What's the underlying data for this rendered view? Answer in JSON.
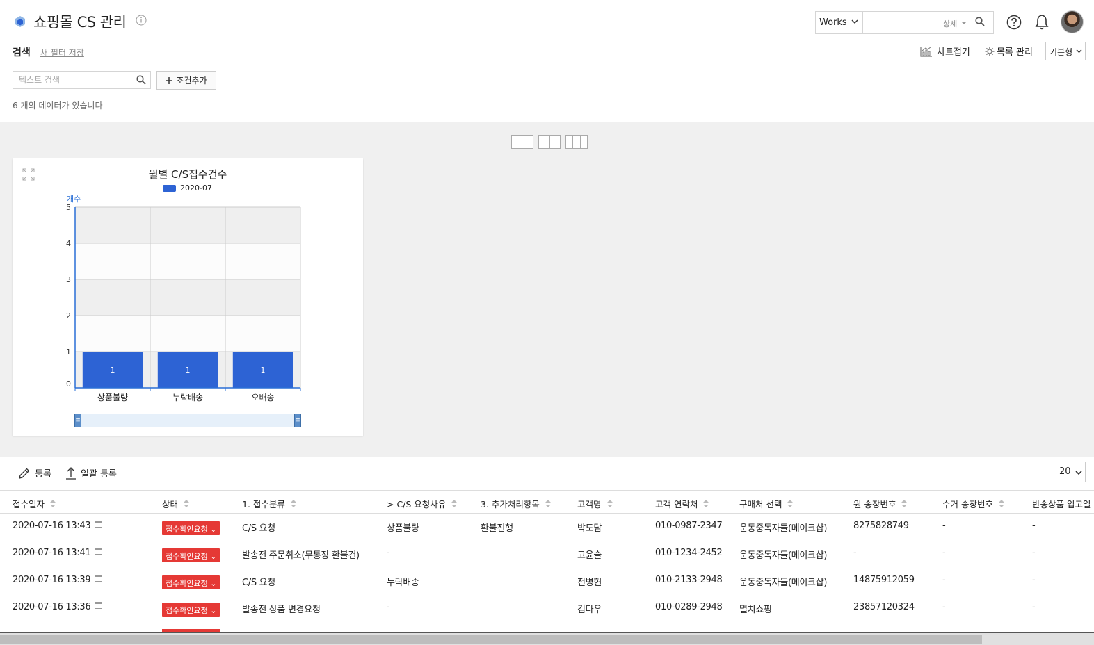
{
  "header": {
    "title": "쇼핑몰 CS 관리",
    "works_select": "Works",
    "detail_label": "상세",
    "chart_collapse_label": "차트접기",
    "list_manage_label": "목록 관리",
    "view_mode": "기본형"
  },
  "filter": {
    "search_label": "검색",
    "save_filter_label": "새 필터 저장",
    "text_search_placeholder": "텍스트 검색",
    "add_condition_label": "조건추가",
    "data_count_text": "6 개의 데이터가 있습니다"
  },
  "chart_data": {
    "type": "bar",
    "title": "월별 C/S접수건수",
    "ylabel": "개수",
    "xlabel": "",
    "categories": [
      "상품불량",
      "누락배송",
      "오배송"
    ],
    "series": [
      {
        "name": "2020-07",
        "values": [
          1,
          1,
          1
        ],
        "color": "#2d63d4"
      }
    ],
    "ylim": [
      0,
      5
    ],
    "yticks": [
      0,
      1,
      2,
      3,
      4,
      5
    ],
    "grid": true,
    "legend": "top"
  },
  "toolbar": {
    "register_label": "등록",
    "bulk_register_label": "일괄 등록",
    "page_size": "20"
  },
  "table": {
    "columns": [
      "접수일자",
      "상태",
      "1. 접수분류",
      "> C/S 요청사유",
      "3. 추가처리항목",
      "고객명",
      "고객 연락처",
      "구매처 선택",
      "원 송장번호",
      "수거 송장번호",
      "반송상품 입고일"
    ],
    "rows": [
      {
        "date": "2020-07-16 13:43",
        "status": "접수확인요청",
        "category": "C/S 요청",
        "reason": "상품불량",
        "extra": "환불진행",
        "name": "박도담",
        "phone": "010-0987-2347",
        "shop": "운동중독자들(메이크샵)",
        "invoice": "8275828749",
        "pickup": "-",
        "returned": "-"
      },
      {
        "date": "2020-07-16 13:41",
        "status": "접수확인요청",
        "category": "발송전 주문취소(무통장 환불건)",
        "reason": "-",
        "extra": "",
        "name": "고윤슬",
        "phone": "010-1234-2452",
        "shop": "운동중독자들(메이크샵)",
        "invoice": "-",
        "pickup": "-",
        "returned": "-"
      },
      {
        "date": "2020-07-16 13:39",
        "status": "접수확인요청",
        "category": "C/S 요청",
        "reason": "누락배송",
        "extra": "",
        "name": "전병현",
        "phone": "010-2133-2948",
        "shop": "운동중독자들(메이크샵)",
        "invoice": "14875912059",
        "pickup": "-",
        "returned": "-"
      },
      {
        "date": "2020-07-16 13:36",
        "status": "접수확인요청",
        "category": "발송전 상품 변경요청",
        "reason": "-",
        "extra": "",
        "name": "김다우",
        "phone": "010-0289-2948",
        "shop": "멸치쇼핑",
        "invoice": "23857120324",
        "pickup": "-",
        "returned": "-"
      }
    ]
  }
}
